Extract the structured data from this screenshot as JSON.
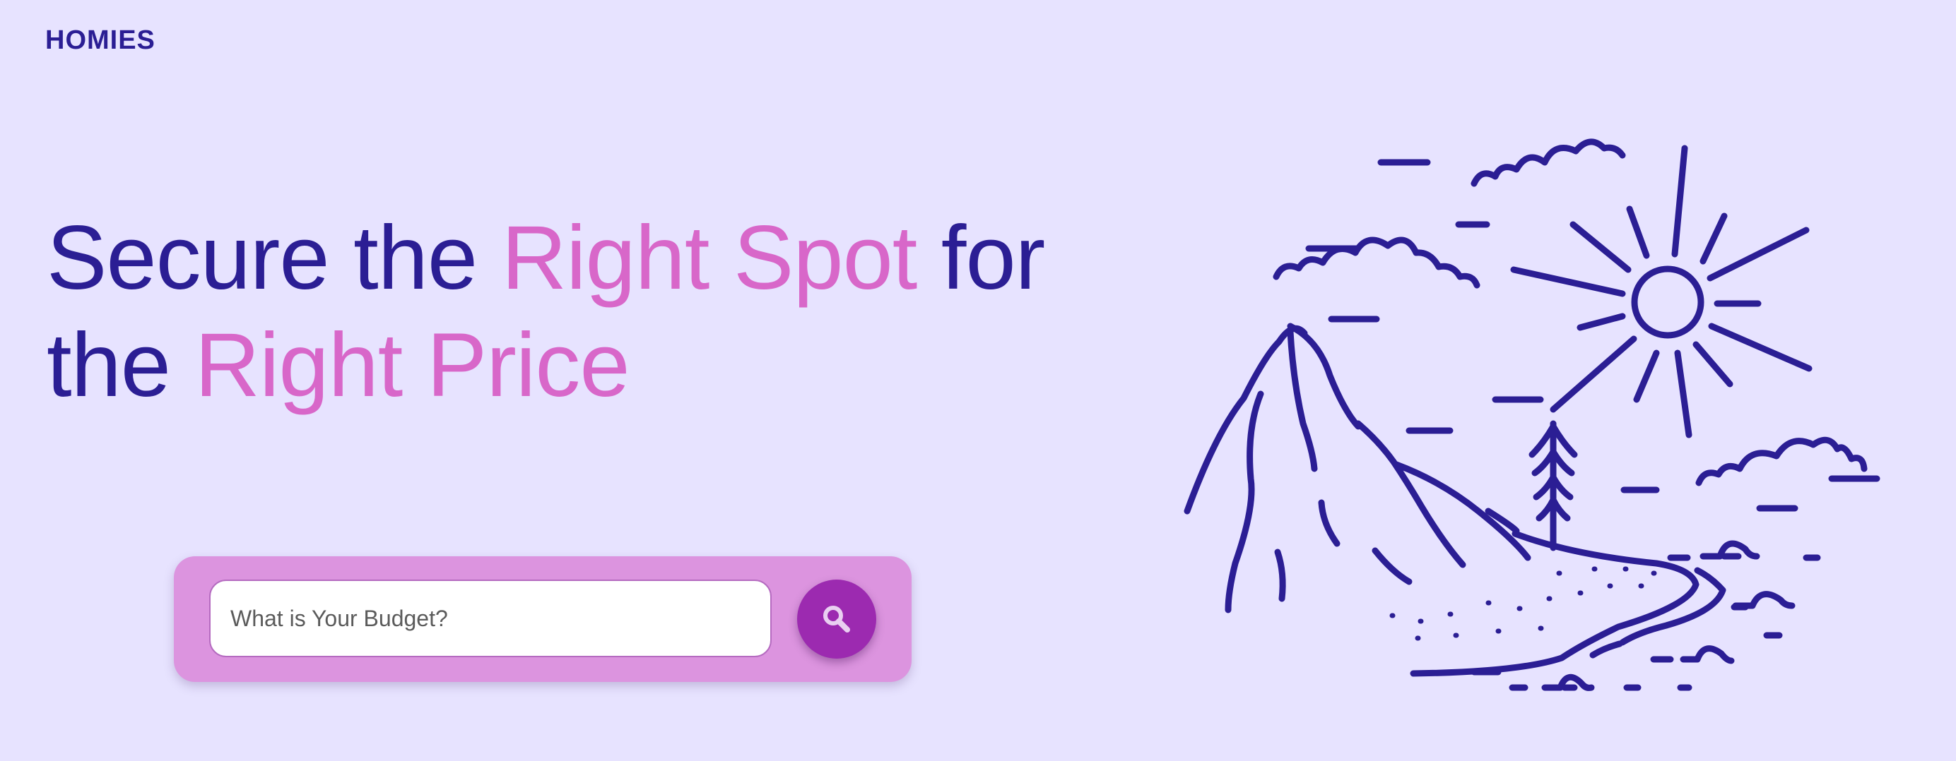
{
  "header": {
    "brand": "HOMIES"
  },
  "hero": {
    "title_line1_a": "Secure the ",
    "title_line1_accent": "Right Spot",
    "title_line1_b": " for",
    "title_line2_a": "the ",
    "title_line2_accent": "Right Price"
  },
  "search": {
    "placeholder": "What is Your Budget?",
    "value": ""
  },
  "icons": {
    "search_button_icon": "search-icon",
    "illustration": "mountain-sun-landscape-illustration"
  },
  "colors": {
    "background": "#E7E3FF",
    "primary_text": "#2B1E94",
    "accent_text": "#D867C9",
    "panel": "#DC94DF",
    "search_button": "#9C2AB0"
  }
}
